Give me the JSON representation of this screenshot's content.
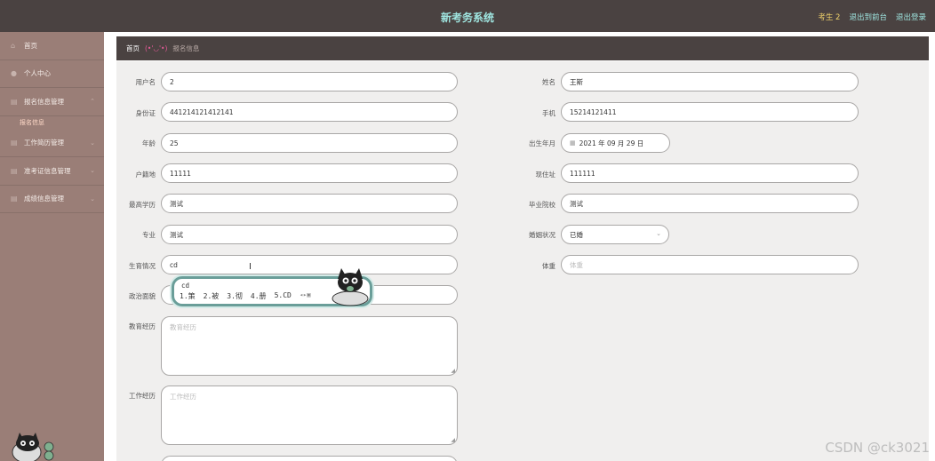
{
  "app": {
    "title": "新考务系统",
    "user": "考生 2",
    "back_admin": "退出到前台",
    "logout": "退出登录"
  },
  "sidebar": {
    "items": [
      {
        "label": "首页",
        "icon": "home-icon"
      },
      {
        "label": "个人中心",
        "icon": "user-icon"
      },
      {
        "label": "报名信息管理",
        "icon": "list-icon",
        "sub": "报名信息"
      },
      {
        "label": "工作简历管理",
        "icon": "list-icon"
      },
      {
        "label": "准考证信息管理",
        "icon": "list-icon"
      },
      {
        "label": "成绩信息管理",
        "icon": "list-icon"
      }
    ]
  },
  "breadcrumb": {
    "home": "首页",
    "face": "(•'◡'•)",
    "current": "报名信息"
  },
  "form": {
    "username": {
      "label": "用户名",
      "value": "2"
    },
    "name": {
      "label": "姓名",
      "value": "王斯"
    },
    "idcard": {
      "label": "身份证",
      "value": "441214121412141"
    },
    "phone": {
      "label": "手机",
      "value": "15214121411"
    },
    "age": {
      "label": "年龄",
      "value": "25"
    },
    "birth": {
      "label": "出生年月",
      "value": "2021 年 09 月 29 日"
    },
    "hukou": {
      "label": "户籍地",
      "value": "11111"
    },
    "address": {
      "label": "现住址",
      "value": "111111"
    },
    "education": {
      "label": "最高学历",
      "value": "测试"
    },
    "school": {
      "label": "毕业院校",
      "value": "测试"
    },
    "major": {
      "label": "专业",
      "value": "测试"
    },
    "marital": {
      "label": "婚姻状况",
      "value": "已婚"
    },
    "fertility": {
      "label": "生育情况",
      "value": "cd"
    },
    "weight": {
      "label": "体重",
      "placeholder": "体重"
    },
    "politics": {
      "label": "政治面貌"
    },
    "edu_exp": {
      "label": "教育经历",
      "placeholder": "教育经历"
    },
    "work_exp": {
      "label": "工作经历",
      "placeholder": "工作经历"
    }
  },
  "ime": {
    "input": "cd",
    "candidates": [
      "1.策",
      "2.被",
      "3.彻",
      "4.册",
      "5.CD"
    ]
  },
  "watermark": "CSDN @ck3021"
}
